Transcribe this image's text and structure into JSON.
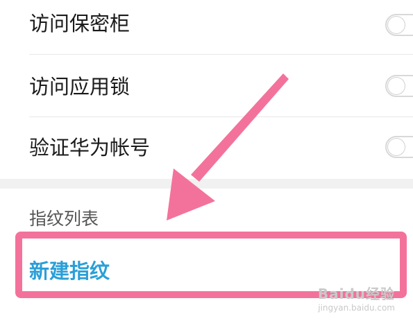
{
  "settings": [
    {
      "label": "访问保密柜",
      "enabled": false
    },
    {
      "label": "访问应用锁",
      "enabled": false
    },
    {
      "label": "验证华为帐号",
      "enabled": false
    }
  ],
  "fingerprint_section": {
    "title": "指纹列表",
    "new_fingerprint": "新建指纹"
  },
  "watermark": {
    "brand": "Baidu经验",
    "url": "jingyan.baidu.com"
  },
  "colors": {
    "arrow": "#f3729b",
    "highlight_box": "#f3729b",
    "link_text": "#2a9fd8"
  }
}
